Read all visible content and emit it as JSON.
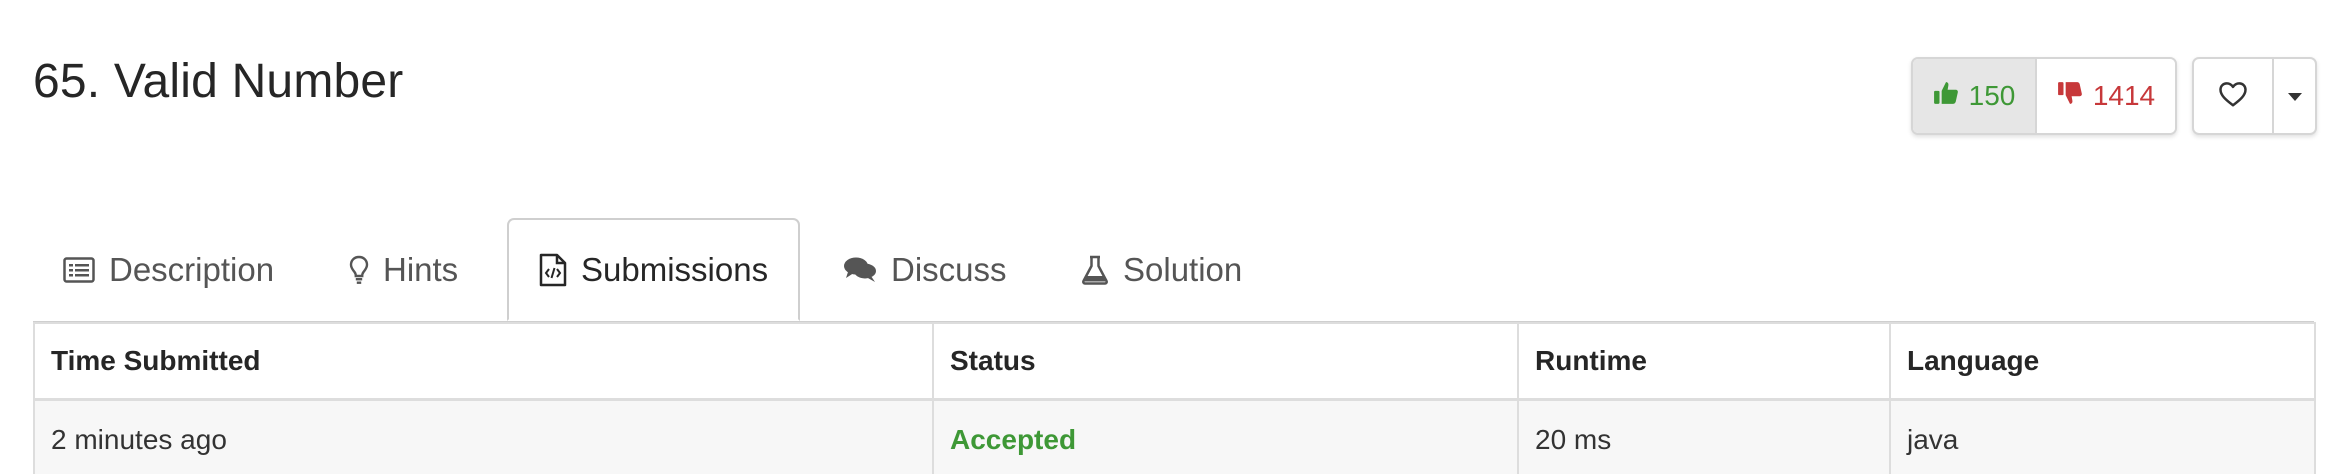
{
  "problem": {
    "title": "65. Valid Number"
  },
  "votes": {
    "likes": "150",
    "dislikes": "1414",
    "like_color": "#3e9836",
    "dislike_color": "#c7383a"
  },
  "tabs": [
    {
      "label": "Description",
      "icon": "list-icon",
      "active": false
    },
    {
      "label": "Hints",
      "icon": "lightbulb-icon",
      "active": false
    },
    {
      "label": "Submissions",
      "icon": "code-file-icon",
      "active": true
    },
    {
      "label": "Discuss",
      "icon": "comments-icon",
      "active": false
    },
    {
      "label": "Solution",
      "icon": "flask-icon",
      "active": false
    }
  ],
  "submissions": {
    "columns": [
      "Time Submitted",
      "Status",
      "Runtime",
      "Language"
    ],
    "rows": [
      {
        "time": "2 minutes ago",
        "status": "Accepted",
        "runtime": "20 ms",
        "language": "java"
      }
    ],
    "status_accepted_color": "#3e9836"
  }
}
